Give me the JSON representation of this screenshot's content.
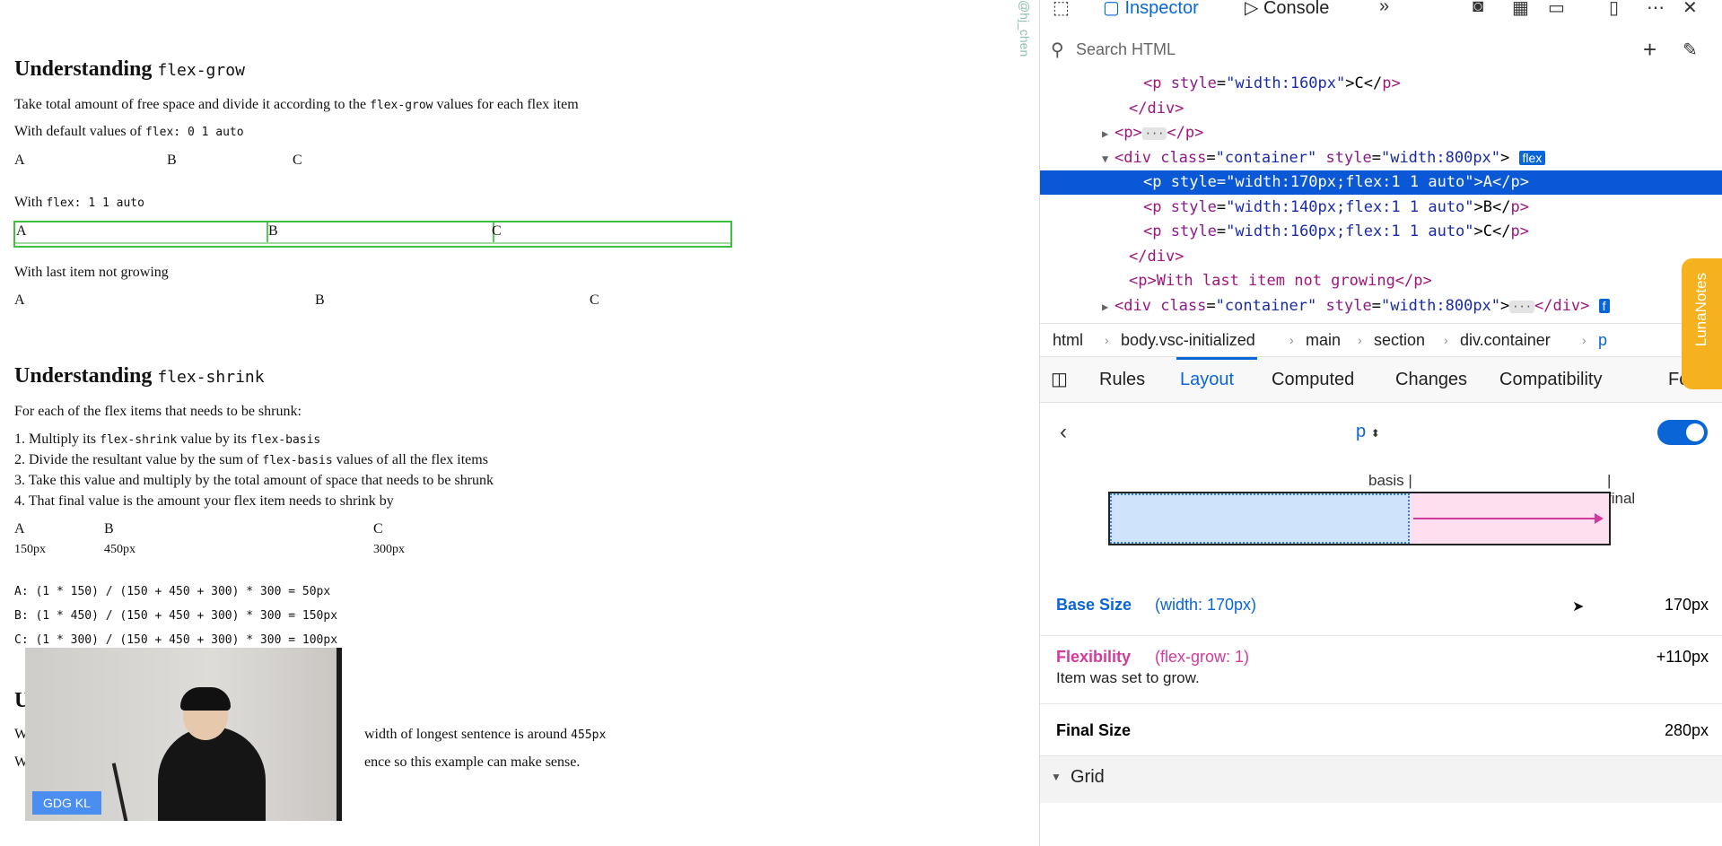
{
  "page": {
    "s1": {
      "title": "Understanding",
      "title_code": "flex-grow",
      "desc": "Take total amount of free space and divide it according to the",
      "desc_code": "flex-grow",
      "desc_tail": "values for each flex item",
      "default_label": "With default values of",
      "default_code": "flex: 0 1 auto",
      "row1": [
        "A",
        "B",
        "C"
      ],
      "with_label": "With",
      "with_code": "flex: 1 1 auto",
      "row2": [
        "A",
        "B",
        "C"
      ],
      "last_label": "With last item not growing",
      "row3": [
        "A",
        "B",
        "C"
      ]
    },
    "s2": {
      "title": "Understanding",
      "title_code": "flex-shrink",
      "intro": "For each of the flex items that needs to be shrunk:",
      "step1_a": "1. Multiply its",
      "step1_code1": "flex-shrink",
      "step1_b": "value by its",
      "step1_code2": "flex-basis",
      "step2_a": "2. Divide the resultant value by the sum of",
      "step2_code": "flex-basis",
      "step2_b": "values of all the flex items",
      "step3": "3. Take this value and multiply by the total amount of space that needs to be shrunk",
      "step4": "4. That final value is the amount your flex item needs to shrink by",
      "letters": [
        "A",
        "B",
        "C"
      ],
      "sizes": [
        "150px",
        "450px",
        "300px"
      ],
      "calc": [
        "A: (1 * 150) / (150 + 450 + 300) * 300 = 50px",
        "B: (1 * 450) / (150 + 450 + 300) * 300 = 150px",
        "C: (1 * 300) / (150 + 450 + 300) * 300 = 100px"
      ]
    },
    "s3": {
      "heading_fragment": "U",
      "line1_start": "W",
      "line1": "width of longest sentence is around",
      "line1_code": "455px",
      "line2_start": "W",
      "line2": "ence so this example can make sense."
    },
    "watermark": "@hj_chen",
    "video_badge": "GDG KL"
  },
  "devtools": {
    "tabs": {
      "inspector": "Inspector",
      "console": "Console"
    },
    "search_placeholder": "Search HTML",
    "tree": [
      {
        "indent": 6,
        "open": "<p",
        "attrs": [
          [
            "style",
            "width:160px"
          ]
        ],
        "text": ">C</",
        "close": "p>"
      },
      {
        "indent": 5,
        "open": "</div>"
      },
      {
        "indent": 4,
        "twisty": "▶",
        "open": "<p>",
        "ellipsis": "···",
        "close": "</p>"
      },
      {
        "indent": 4,
        "twisty": "▼",
        "open": "<div",
        "attrs": [
          [
            "class",
            "container"
          ],
          [
            "style",
            "width:800px"
          ]
        ],
        "text": ">",
        "badge": "flex"
      },
      {
        "indent": 6,
        "open": "<p",
        "attrs": [
          [
            "style",
            "width:170px;flex:1 1 auto"
          ]
        ],
        "text": ">A</",
        "close": "p>",
        "selected": true
      },
      {
        "indent": 6,
        "open": "<p",
        "attrs": [
          [
            "style",
            "width:140px;flex:1 1 auto"
          ]
        ],
        "text": ">B</",
        "close": "p>"
      },
      {
        "indent": 6,
        "open": "<p",
        "attrs": [
          [
            "style",
            "width:160px;flex:1 1 auto"
          ]
        ],
        "text": ">C</",
        "close": "p>"
      },
      {
        "indent": 5,
        "open": "</div>"
      },
      {
        "indent": 5,
        "open": "<p>With last item not growing</p>"
      },
      {
        "indent": 4,
        "twisty": "▶",
        "open": "<div",
        "attrs": [
          [
            "class",
            "container"
          ],
          [
            "style",
            "width:800px"
          ]
        ],
        "text": ">",
        "ellipsis": "···",
        "close": "</div>",
        "badge_cut": "f"
      }
    ],
    "breadcrumbs": [
      "html",
      "body.vsc-initialized",
      "main",
      "section",
      "div.container",
      "p"
    ],
    "subtabs": [
      "Rules",
      "Layout",
      "Computed",
      "Changes",
      "Compatibility",
      "Fon"
    ],
    "layout": {
      "element": "p",
      "basis_label": "basis",
      "final_label": "final",
      "base_size": {
        "name": "Base Size",
        "detail": "(width: 170px)",
        "value": "170px"
      },
      "flexibility": {
        "name": "Flexibility",
        "detail": "(flex-grow: 1)",
        "value": "+110px",
        "desc": "Item was set to grow."
      },
      "final_size": {
        "name": "Final Size",
        "value": "280px"
      },
      "grid": "Grid"
    }
  },
  "extension_tab": "LunaNotes",
  "colors": {
    "accent": "#0a66d6",
    "flex_outline": "#3fbf3f",
    "flexibility": "#d33a9b",
    "lunanotes": "#f5b21e"
  }
}
